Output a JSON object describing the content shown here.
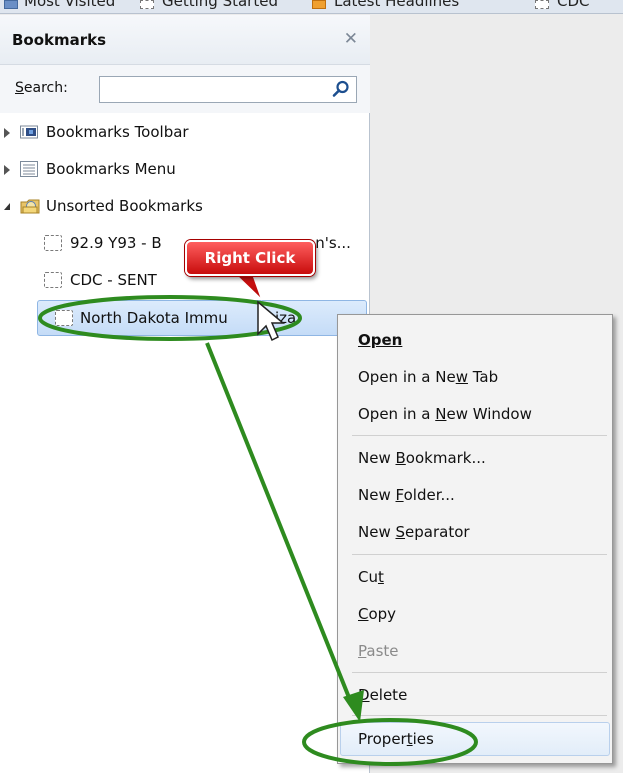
{
  "toolbar": {
    "items": [
      "Most Visited",
      "Getting Started",
      "Latest Headlines",
      "CDC"
    ]
  },
  "sidebar": {
    "title": "Bookmarks",
    "search_label": "Search:",
    "search_value": "",
    "tree": {
      "toolbar_folder": "Bookmarks Toolbar",
      "menu_folder": "Bookmarks Menu",
      "unsorted_folder": "Unsorted Bookmarks",
      "bookmarks": [
        "92.9 Y93 - B",
        "an's...",
        "CDC - SENT",
        "North Dakota Immu",
        "iza"
      ]
    }
  },
  "callout": {
    "label": "Right Click"
  },
  "context_menu": {
    "open": "Open",
    "open_tab_pre": "Open in a Ne",
    "open_tab_key": "w",
    "open_tab_post": " Tab",
    "open_window_pre": "Open in a ",
    "open_window_key": "N",
    "open_window_post": "ew Window",
    "new_bookmark_pre": "New ",
    "new_bookmark_key": "B",
    "new_bookmark_post": "ookmark...",
    "new_folder_pre": "New ",
    "new_folder_key": "F",
    "new_folder_post": "older...",
    "new_separator_pre": "New ",
    "new_separator_key": "S",
    "new_separator_post": "eparator",
    "cut_pre": "Cu",
    "cut_key": "t",
    "copy_key": "C",
    "copy_post": "opy",
    "paste_key": "P",
    "paste_post": "aste",
    "delete_key": "D",
    "delete_post": "elete",
    "properties_pre": "Proper",
    "properties_key": "t",
    "properties_post": "ies"
  },
  "colors": {
    "annotation_green": "#2e8b1f",
    "callout_red": "#d81414",
    "selection_blue": "#c5dcf7"
  }
}
